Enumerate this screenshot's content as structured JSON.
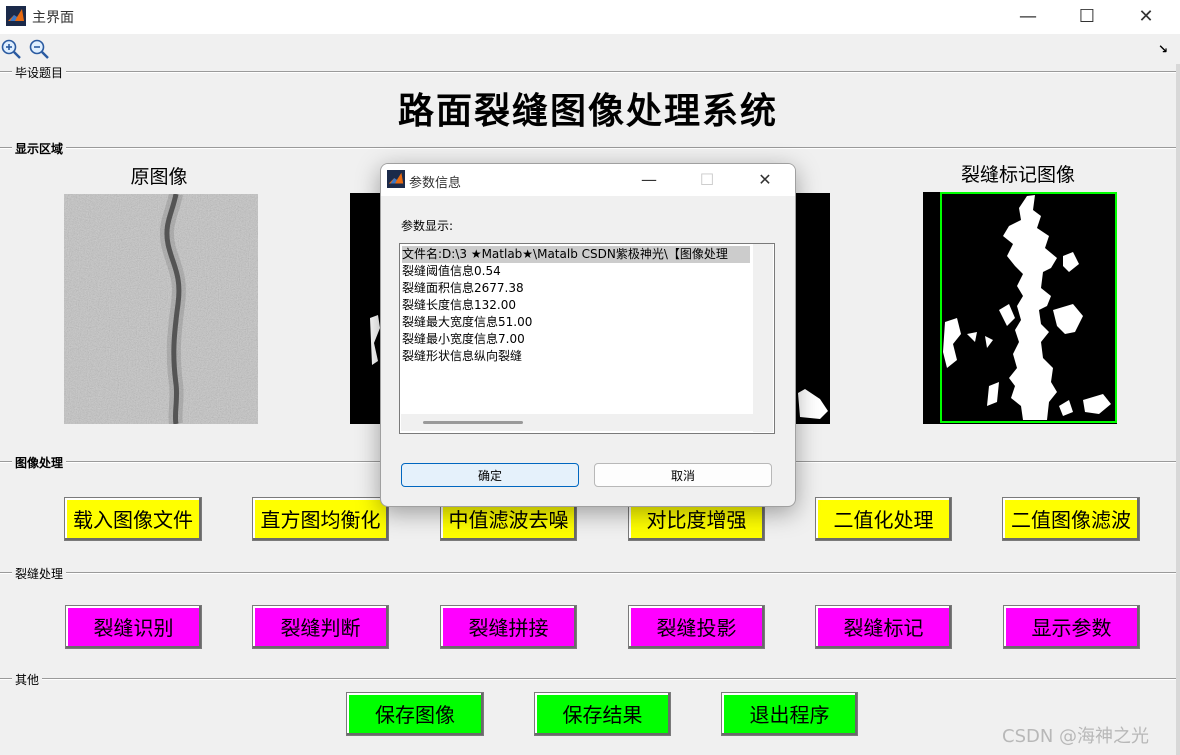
{
  "window": {
    "title": "主界面",
    "minimize": "—",
    "maximize": "☐",
    "close": "✕"
  },
  "toolbar": {
    "zoom_in_icon": "zoom-in-icon",
    "zoom_out_icon": "zoom-out-icon",
    "dock_glyph": "↘"
  },
  "panels": {
    "topic": "毕设题目",
    "display": "显示区域",
    "image_processing": "图像处理",
    "crack_processing": "裂缝处理",
    "other": "其他"
  },
  "main_title": "路面裂缝图像处理系统",
  "display": {
    "original_title": "原图像",
    "marked_title": "裂缝标记图像"
  },
  "image_buttons": [
    "载入图像文件",
    "直方图均衡化",
    "中值滤波去噪",
    "对比度增强",
    "二值化处理",
    "二值图像滤波"
  ],
  "crack_buttons": [
    "裂缝识别",
    "裂缝判断",
    "裂缝拼接",
    "裂缝投影",
    "裂缝标记",
    "显示参数"
  ],
  "other_buttons": [
    "保存图像",
    "保存结果",
    "退出程序"
  ],
  "dialog": {
    "title": "参数信息",
    "minimize": "—",
    "maximize": "☐",
    "close": "✕",
    "label": "参数显示:",
    "items": [
      "文件名:D:\\3 ★Matlab★\\Matalb CSDN紫极神光\\【图像处理",
      "裂缝阈值信息0.54",
      "裂缝面积信息2677.38",
      "裂缝长度信息132.00",
      "裂缝最大宽度信息51.00",
      "裂缝最小宽度信息7.00",
      "裂缝形状信息纵向裂缝"
    ],
    "ok": "确定",
    "cancel": "取消"
  },
  "watermark": "CSDN @海神之光",
  "colors": {
    "yellow_button": "#ffff00",
    "magenta_button": "#ff00ff",
    "green_button": "#00ff00",
    "marker_box": "#00ff00"
  }
}
